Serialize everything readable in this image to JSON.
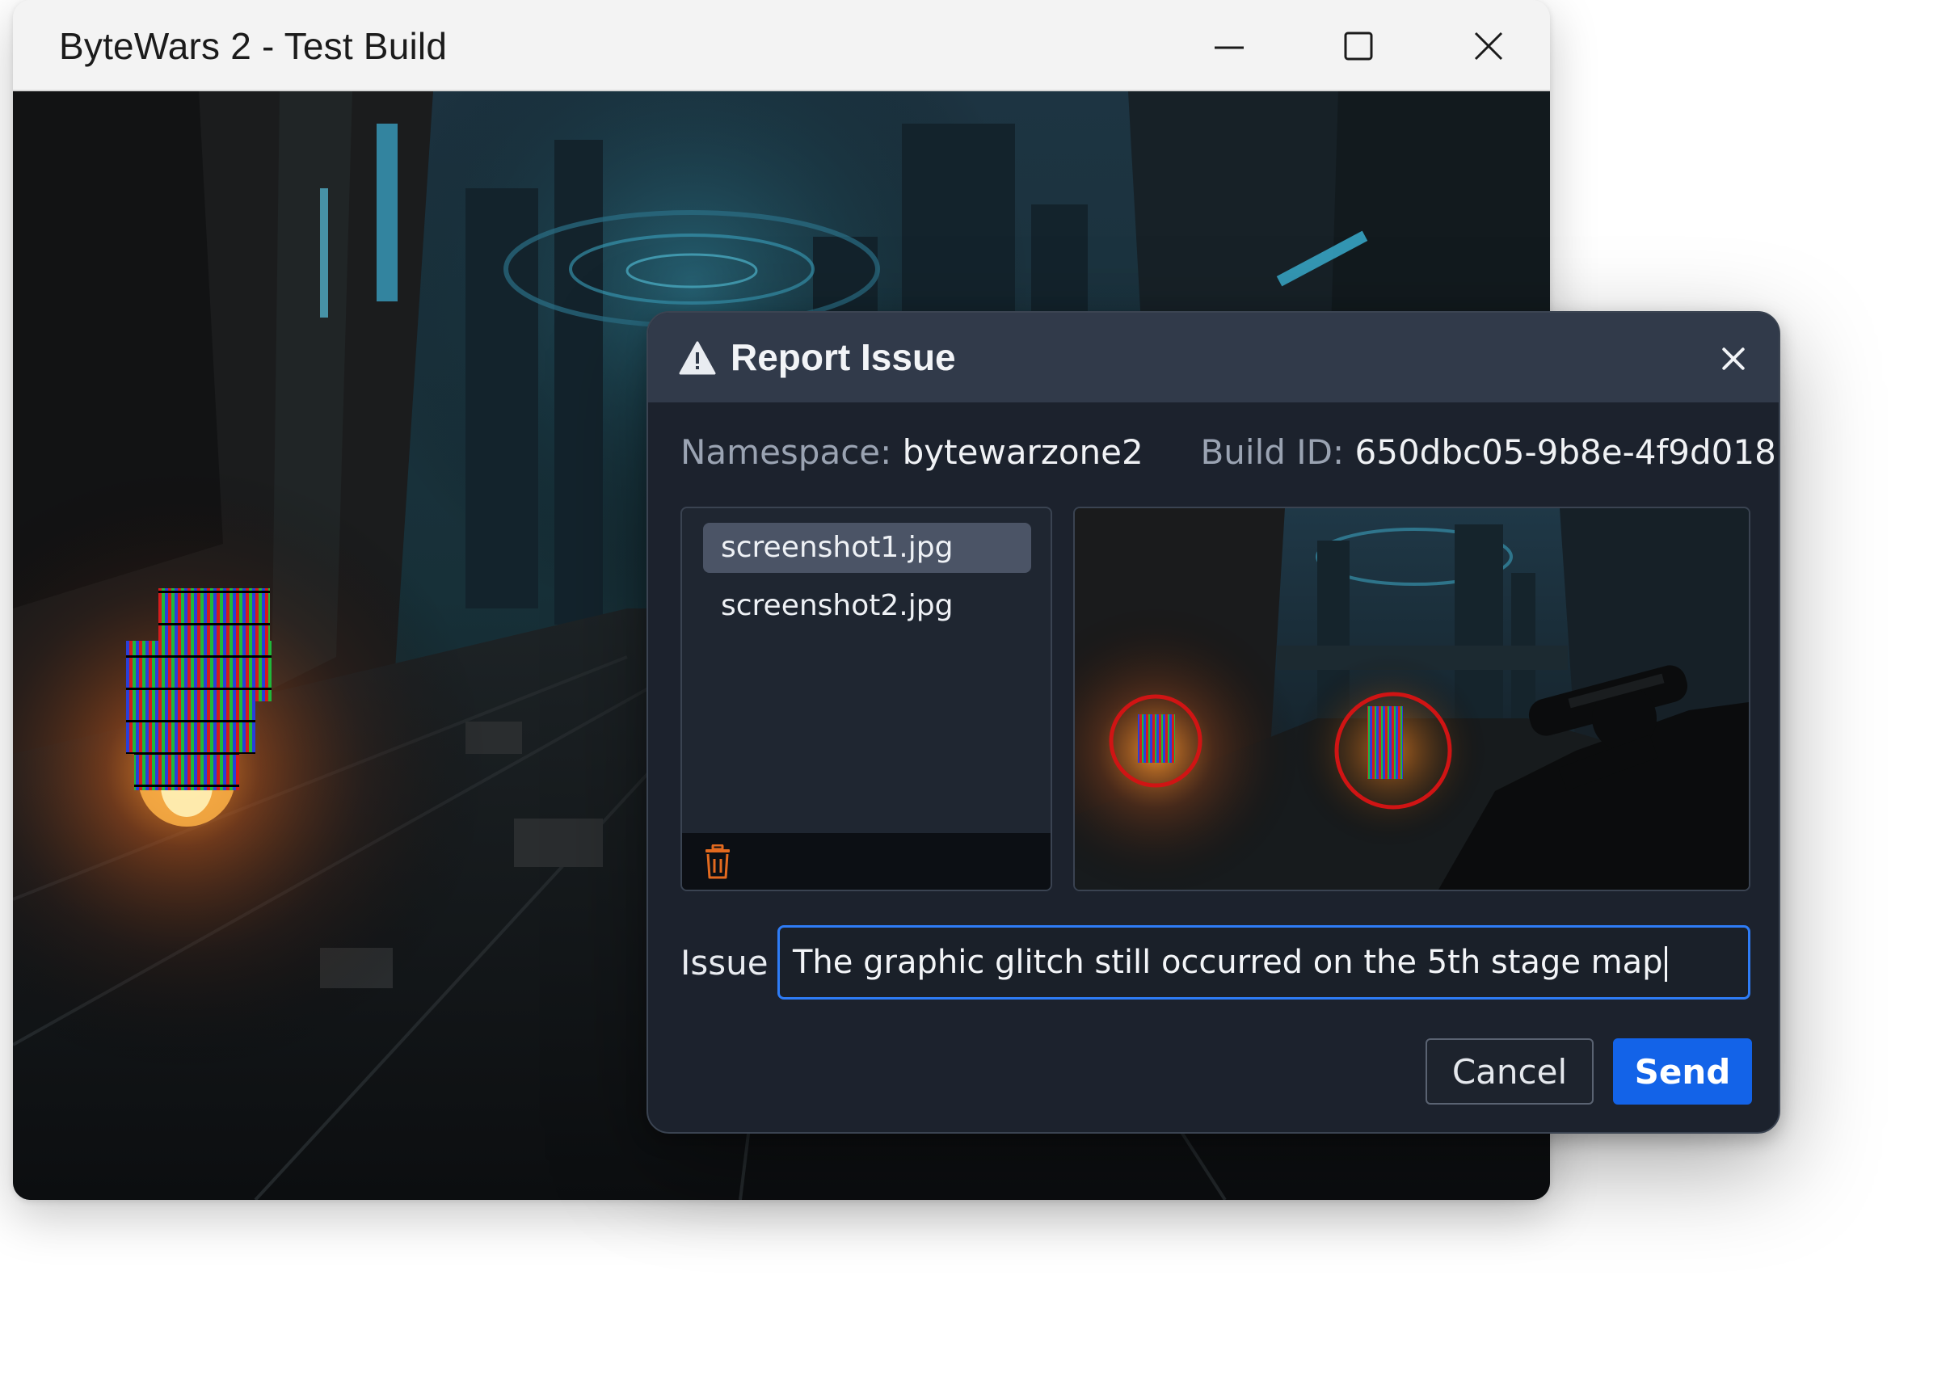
{
  "window": {
    "title": "ByteWars 2 - Test Build",
    "controls": {
      "minimize_icon": "minimize-icon",
      "maximize_icon": "maximize-icon",
      "close_icon": "close-icon"
    }
  },
  "dialog": {
    "title": "Report Issue",
    "title_icon": "warning-icon",
    "close_icon": "close-icon",
    "namespace_label": "Namespace:",
    "namespace_value": "bytewarzone2",
    "build_label": "Build ID:",
    "build_value": "650dbc05-9b8e-4f9d018",
    "files": [
      {
        "name": "screenshot1.jpg",
        "selected": true
      },
      {
        "name": "screenshot2.jpg",
        "selected": false
      }
    ],
    "delete_icon": "trash-icon",
    "issue_label": "Issue",
    "issue_value": "The graphic glitch still occurred on the 5th stage map",
    "cancel_label": "Cancel",
    "send_label": "Send"
  },
  "colors": {
    "accent": "#1363e8",
    "focus_border": "#2e7cf6",
    "dialog_bg": "#1c222d",
    "dialog_header": "#313a4a",
    "trash": "#e36a1f",
    "highlight_ring": "#d01414"
  }
}
